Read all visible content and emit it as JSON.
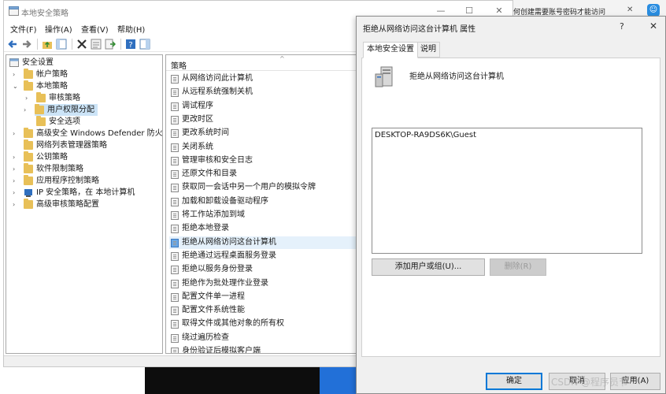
{
  "background": {
    "browser_tab_text": "何创建需要账号密码才能访问",
    "browser_tab_close": "✕",
    "extension_glyph": "☺"
  },
  "mmc": {
    "title": "本地安全策略",
    "window_controls": {
      "minimize": "—",
      "maximize": "☐",
      "close": "✕"
    },
    "menu": [
      "文件(F)",
      "操作(A)",
      "查看(V)",
      "帮助(H)"
    ],
    "tree": [
      {
        "label": "安全设置",
        "expander": "",
        "icon": "security-settings-icon"
      },
      {
        "label": "帐户策略",
        "expander": "›",
        "icon": "folder-icon"
      },
      {
        "label": "本地策略",
        "expander": "⌄",
        "icon": "folder-icon"
      },
      {
        "label": "审核策略",
        "expander": "›",
        "icon": "folder-icon"
      },
      {
        "label": "用户权限分配",
        "expander": "›",
        "icon": "folder-icon"
      },
      {
        "label": "安全选项",
        "expander": "",
        "icon": "folder-icon"
      },
      {
        "label": "高级安全 Windows Defender 防火墙",
        "expander": "›",
        "icon": "folder-icon"
      },
      {
        "label": "网络列表管理器策略",
        "expander": "",
        "icon": "folder-icon"
      },
      {
        "label": "公钥策略",
        "expander": "›",
        "icon": "folder-icon"
      },
      {
        "label": "软件限制策略",
        "expander": "›",
        "icon": "folder-icon"
      },
      {
        "label": "应用程序控制策略",
        "expander": "›",
        "icon": "folder-icon"
      },
      {
        "label": "IP 安全策略，在 本地计算机",
        "expander": "›",
        "icon": "ip-security-icon"
      },
      {
        "label": "高级审核策略配置",
        "expander": "›",
        "icon": "folder-icon"
      }
    ],
    "policy_header": "策略",
    "policy_sort_caret": "^",
    "policies": [
      "从网络访问此计算机",
      "从远程系统强制关机",
      "调试程序",
      "更改时区",
      "更改系统时间",
      "关闭系统",
      "管理审核和安全日志",
      "还原文件和目录",
      "获取同一会话中另一个用户的模拟令牌",
      "加载和卸载设备驱动程序",
      "将工作站添加到域",
      "拒绝本地登录",
      "拒绝从网络访问这台计算机",
      "拒绝通过远程桌面服务登录",
      "拒绝以服务身份登录",
      "拒绝作为批处理作业登录",
      "配置文件单一进程",
      "配置文件系统性能",
      "取得文件或其他对象的所有权",
      "绕过遍历检查",
      "身份验证后模拟客户端"
    ],
    "selected_policy_index": 12
  },
  "dialog": {
    "title": "拒绝从网络访问这台计算机 属性",
    "help": "?",
    "close": "✕",
    "tabs": [
      "本地安全设置",
      "说明"
    ],
    "heading": "拒绝从网络访问这台计算机",
    "accounts": [
      "DESKTOP-RA9DS6K\\Guest"
    ],
    "add_button": "添加用户或组(U)...",
    "remove_button": "删除(R)",
    "ok_button": "确定",
    "cancel_button": "取消",
    "apply_button": "应用(A)"
  },
  "watermark": "CSDN @程序员节"
}
